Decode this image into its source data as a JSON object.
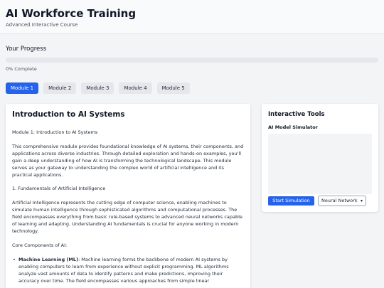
{
  "header": {
    "title": "AI Workforce Training",
    "subtitle": "Advanced Interactive Course"
  },
  "progress": {
    "label": "Your Progress",
    "value_percent": 0,
    "text": "0% Complete",
    "accent_color": "#2563eb"
  },
  "tabs": [
    {
      "label": "Module 1",
      "active": true
    },
    {
      "label": "Module 2",
      "active": false
    },
    {
      "label": "Module 3",
      "active": false
    },
    {
      "label": "Module 4",
      "active": false
    },
    {
      "label": "Module 5",
      "active": false
    }
  ],
  "main": {
    "title": "Introduction to AI Systems",
    "module_heading": "Module 1: Introduction to AI Systems",
    "intro": "This comprehensive module provides foundational knowledge of AI systems, their components, and applications across diverse industries. Through detailed exploration and hands-on examples, you'll gain a deep understanding of how AI is transforming the technological landscape. This module serves as your gateway to understanding the complex world of artificial intelligence and its practical applications.",
    "section_heading": "1. Fundamentals of Artificial Intelligence",
    "section_text": "Artificial Intelligence represents the cutting edge of computer science, enabling machines to simulate human intelligence through sophisticated algorithms and computational processes. The field encompasses everything from basic rule-based systems to advanced neural networks capable of learning and adapting. Understanding AI fundamentals is crucial for anyone working in modern technology.",
    "components_heading": "Core Components of AI:",
    "components": [
      {
        "term": "Machine Learning (ML)",
        "text": ": Machine learning forms the backbone of modern AI systems by enabling computers to learn from experience without explicit programming. ML algorithms analyze vast amounts of data to identify patterns and make predictions, improving their accuracy over time. The field encompasses various approaches from simple linear"
      }
    ]
  },
  "tools": {
    "title": "Interactive Tools",
    "simulator_title": "AI Model Simulator",
    "start_label": "Start Simulation",
    "model_selected": "Neural Network",
    "dropdown_icon": "chevron-down-icon"
  }
}
